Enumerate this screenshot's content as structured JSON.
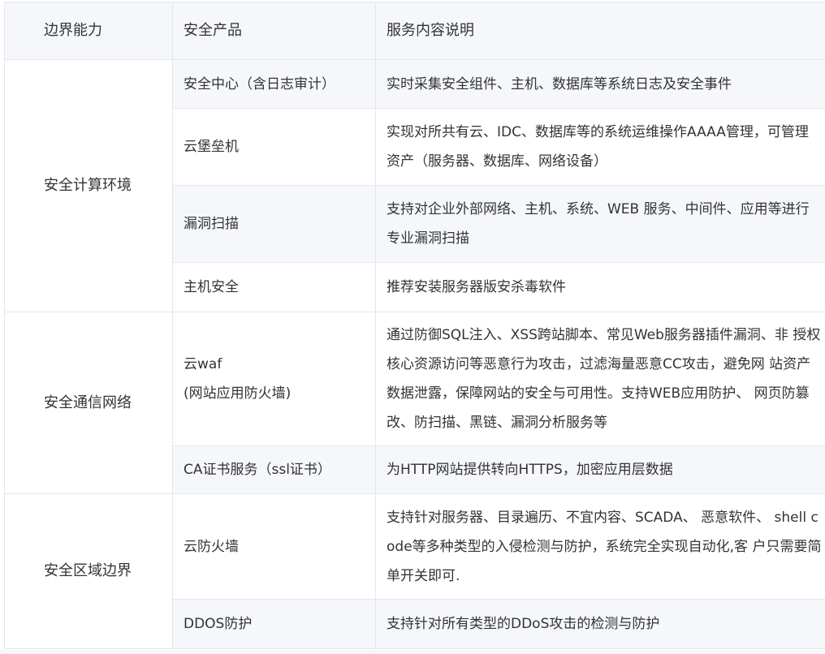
{
  "header": {
    "col1": "边界能力",
    "col2": "安全产品",
    "col3": "服务内容说明"
  },
  "groups": [
    {
      "name": "安全计算环境",
      "rows": [
        {
          "product": "安全中心（含日志审计）",
          "desc": "实时采集安全组件、主机、数据库等系统日志及安全事件"
        },
        {
          "product": "云堡垒机",
          "desc": "实现对所共有云、IDC、数据库等的系统运维操作AAAA管理，可管理资产（服务器、数据库、网络设备）"
        },
        {
          "product": "漏洞扫描",
          "desc": "支持对企业外部网络、主机、系统、WEB 服务、中间件、应用等进行专业漏洞扫描"
        },
        {
          "product": "主机安全",
          "desc": "推荐安装服务器版安杀毒软件"
        }
      ]
    },
    {
      "name": "安全通信网络",
      "rows": [
        {
          "product": "云waf\n(网站应用防火墙)",
          "desc": "通过防御SQL注入、XSS跨站脚本、常见Web服务器插件漏洞、非 授权核心资源访问等恶意行为攻击，过滤海量恶意CC攻击，避免网 站资产数据泄露，保障网站的安全与可用性。支持WEB应用防护、 网页防篡改、防扫描、黑链、漏洞分析服务等"
        },
        {
          "product": "CA证书服务（ssl证书）",
          "desc": "为HTTP网站提供转向HTTPS，加密应用层数据"
        }
      ]
    },
    {
      "name": "安全区域边界",
      "rows": [
        {
          "product": "云防火墙",
          "desc": "支持针对服务器、目录遍历、不宜内容、SCADA、 恶意软件、 shell code等多种类型的入侵检测与防护，系统完全实现自动化,客 户只需要简单开关即可."
        },
        {
          "product": "DDOS防护",
          "desc": "支持针对所有类型的DDoS攻击的检测与防护"
        }
      ]
    }
  ]
}
